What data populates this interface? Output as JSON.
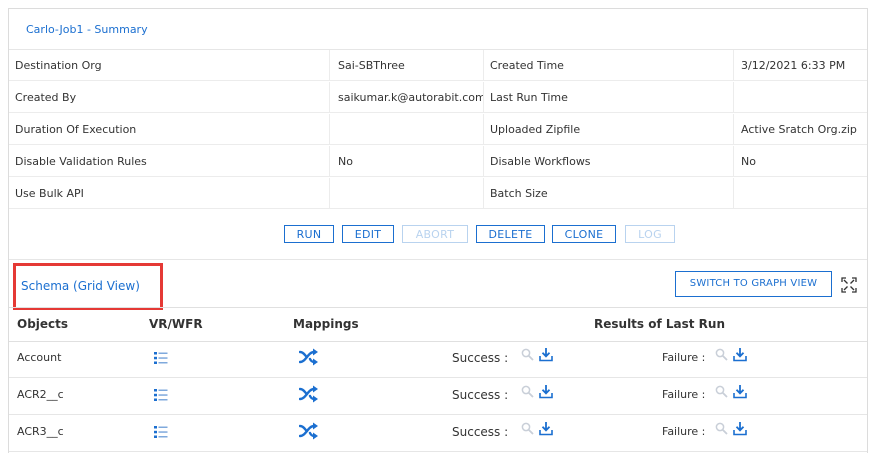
{
  "summary": {
    "title": "Carlo-Job1 - Summary",
    "rows": [
      {
        "label1": "Destination Org",
        "value1": "Sai-SBThree",
        "label2": "Created Time",
        "value2": "3/12/2021 6:33 PM"
      },
      {
        "label1": "Created By",
        "value1": "saikumar.k@autorabit.com",
        "label2": "Last Run Time",
        "value2": ""
      },
      {
        "label1": "Duration Of Execution",
        "value1": "",
        "label2": "Uploaded Zipfile",
        "value2": "Active Sratch Org.zip"
      },
      {
        "label1": "Disable Validation Rules",
        "value1": "No",
        "label2": "Disable Workflows",
        "value2": "No"
      },
      {
        "label1": "Use Bulk API",
        "value1": "",
        "label2": "Batch Size",
        "value2": ""
      }
    ]
  },
  "actions": {
    "run": "RUN",
    "edit": "EDIT",
    "abort": "ABORT",
    "delete": "DELETE",
    "clone": "CLONE",
    "log": "LOG"
  },
  "schema": {
    "title": "Schema (Grid View)",
    "switch_button": "SWITCH TO GRAPH VIEW",
    "expand_icon": "expand-icon",
    "headers": {
      "objects": "Objects",
      "vrwfr": "VR/WFR",
      "mappings": "Mappings",
      "results": "Results of Last Run"
    },
    "success_label": "Success :",
    "failure_label": "Failure :",
    "rows": [
      {
        "object": "Account"
      },
      {
        "object": "ACR2__c"
      },
      {
        "object": "ACR3__c"
      }
    ]
  },
  "colors": {
    "accent": "#1b6fd0",
    "highlight": "#e53935",
    "disabled": "#b9d3ef",
    "icon_light": "#a9c8ef"
  }
}
